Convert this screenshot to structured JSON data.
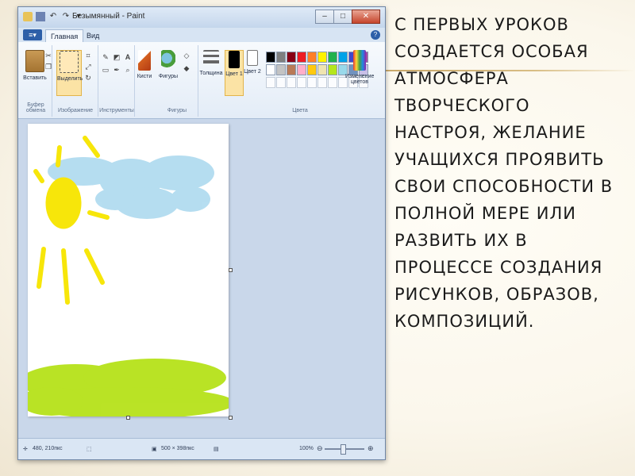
{
  "window": {
    "title": "Безымянный - Paint",
    "minimize": "–",
    "maximize": "□",
    "close": "✕"
  },
  "tabs": {
    "app_menu": "≡▾",
    "home": "Главная",
    "view": "Вид",
    "help": "?"
  },
  "ribbon": {
    "clipboard": {
      "paste": "Вставить",
      "group": "Буфер обмена"
    },
    "image": {
      "select": "Выделить",
      "group": "Изображение"
    },
    "tools": {
      "group": "Инструменты",
      "text_tool": "A"
    },
    "brushes": {
      "label": "Кисти"
    },
    "shapes": {
      "label": "Фигуры",
      "group": "Фигуры"
    },
    "size": {
      "label": "Толщина"
    },
    "colors": {
      "color1": "Цвет 1",
      "color2": "Цвет 2",
      "edit": "Изменение цветов",
      "group": "Цвета",
      "row1": [
        "#000000",
        "#7f7f7f",
        "#880015",
        "#ed1c24",
        "#ff7f27",
        "#fff200",
        "#22b14c",
        "#00a2e8",
        "#3f48cc",
        "#a349a4"
      ],
      "row2": [
        "#ffffff",
        "#c3c3c3",
        "#b97a57",
        "#ffaec9",
        "#ffc90e",
        "#efe4b0",
        "#b5e61d",
        "#99d9ea",
        "#7092be",
        "#c8bfe7"
      ],
      "color1_value": "#000000",
      "color2_value": "#ffffff"
    }
  },
  "status": {
    "cursor_pos": "480, 210пкс",
    "canvas_size": "500 × 398пкс",
    "zoom": "100%",
    "zoom_minus": "⊖",
    "zoom_plus": "⊕"
  },
  "drawing": {
    "sun_color": "#f7e60a",
    "sky_color": "#a9d8ee",
    "grass_color": "#b6e21a"
  },
  "slide_text": "С первых уроков создается особая атмосфера творческого настроя, желание учащихся проявить свои способности в полной мере или развить их в процессе создания рисунков, образов, композиций."
}
